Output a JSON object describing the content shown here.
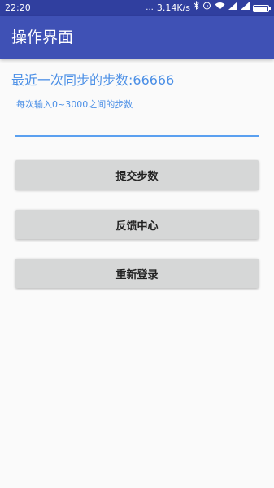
{
  "status_bar": {
    "time": "22:20",
    "dots": "...",
    "network_speed": "3.14K/s",
    "icons": [
      "bluetooth-icon",
      "alarm-icon",
      "wifi-icon",
      "signal-icon",
      "signal-icon",
      "battery-icon"
    ]
  },
  "app_bar": {
    "title": "操作界面"
  },
  "main": {
    "last_sync_text": "最近一次同步的步数:66666",
    "input_hint": "每次输入0~3000之间的步数",
    "step_input_value": ""
  },
  "buttons": {
    "submit_label": "提交步数",
    "feedback_label": "反馈中心",
    "relogin_label": "重新登录"
  },
  "colors": {
    "status_bar": "#303f9f",
    "app_bar": "#3f51b5",
    "accent_text": "#4b8fe6",
    "button_bg": "#d6d7d7",
    "background": "#fafafa"
  }
}
